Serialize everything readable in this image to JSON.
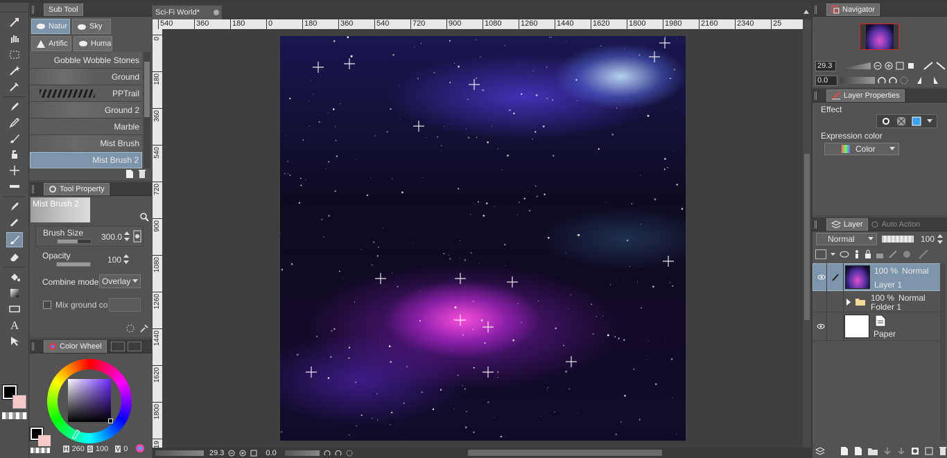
{
  "subtool": {
    "title": "Sub Tool",
    "tabs": [
      {
        "label": "Natur"
      },
      {
        "label": "Sky"
      },
      {
        "label": "Artific"
      },
      {
        "label": "Huma"
      }
    ],
    "brushes": [
      {
        "label": "Gobble Wobble Stones"
      },
      {
        "label": "Ground"
      },
      {
        "label": "PPTrail"
      },
      {
        "label": "Ground 2"
      },
      {
        "label": "Marble"
      },
      {
        "label": "Mist Brush"
      },
      {
        "label": "Mist Brush 2"
      }
    ]
  },
  "tool_property": {
    "title": "Tool Property",
    "preview_name": "Mist Brush 2",
    "brush_size_label": "Brush Size",
    "brush_size_value": "300.0",
    "brush_size_level": 0.6,
    "opacity_label": "Opacity",
    "opacity_value": "100",
    "opacity_level": 1.0,
    "combine_label": "Combine mode",
    "combine_value": "Overlay",
    "mix_label": "Mix ground co"
  },
  "color_wheel": {
    "title": "Color Wheel",
    "h_label": "H",
    "h_value": "260",
    "s_label": "S",
    "s_value": "100",
    "v_label": "V",
    "v_value": "0",
    "main_color": "#000000",
    "sub_color": "#f7c9c9"
  },
  "document": {
    "tab_label": "Sci-Fi World*",
    "ruler_h": [
      "540",
      "360",
      "180",
      "0",
      "180",
      "360",
      "540",
      "720",
      "900",
      "1080",
      "1260",
      "1440",
      "1620",
      "1800",
      "1980",
      "2160",
      "2340",
      "25"
    ],
    "ruler_v": [
      "0",
      "180",
      "360",
      "540",
      "720",
      "900",
      "1080",
      "1260",
      "1440",
      "1620",
      "1800",
      "19"
    ],
    "zoom_value": "29.3",
    "rotate_value": "0.0"
  },
  "navigator": {
    "title": "Navigator",
    "zoom_value": "29.3",
    "rotate_value": "0.0"
  },
  "layer_property": {
    "title": "Layer Properties",
    "effect_label": "Effect",
    "expression_label": "Expression color",
    "expression_value": "Color"
  },
  "layer": {
    "title": "Layer",
    "tab2": "Auto Action",
    "blend_mode": "Normal",
    "opacity": "100",
    "rows": [
      {
        "opacity": "100 %",
        "mode": "Normal",
        "name": "Layer 1"
      },
      {
        "opacity": "100 %",
        "mode": "Normal",
        "name": "Folder 1"
      },
      {
        "name": "Paper"
      }
    ]
  }
}
